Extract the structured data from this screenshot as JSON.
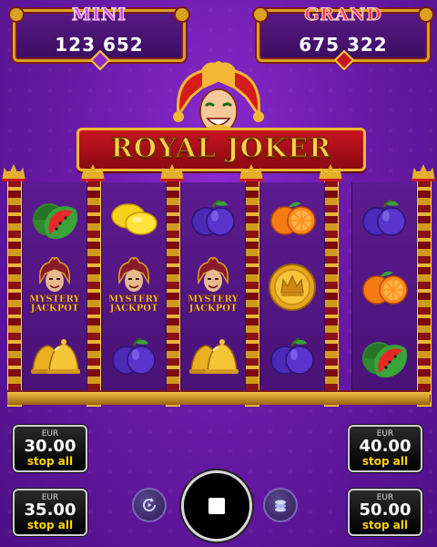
{
  "game": {
    "logo_text": "ROYAL JOKER"
  },
  "jackpots": {
    "mini": {
      "label": "MINI",
      "value": "123 652"
    },
    "grand": {
      "label": "GRAND",
      "value": "675 322"
    }
  },
  "reels": [
    [
      "watermelon-icon",
      "mystery-jackpot-icon",
      "bells-icon"
    ],
    [
      "lemon-icon",
      "mystery-jackpot-icon",
      "plums-icon"
    ],
    [
      "plums-icon",
      "mystery-jackpot-icon",
      "bells-icon"
    ],
    [
      "oranges-icon",
      "crown-coin-icon",
      "plums-icon"
    ],
    [
      "plums-icon",
      "oranges-icon",
      "watermelon-icon"
    ]
  ],
  "mystery_jackpot_label": "MYSTERY JACKPOT",
  "bet_buttons": [
    {
      "currency": "EUR",
      "amount": "30.00",
      "action": "stop all"
    },
    {
      "currency": "EUR",
      "amount": "35.00",
      "action": "stop all"
    },
    {
      "currency": "EUR",
      "amount": "40.00",
      "action": "stop all"
    },
    {
      "currency": "EUR",
      "amount": "50.00",
      "action": "stop all"
    }
  ],
  "controls": {
    "autoplay_icon": "autoplay-icon",
    "spin_icon": "stop-icon",
    "stake_icon": "coins-stack-icon"
  },
  "colors": {
    "background": "#6a1aa8",
    "gold": "#d9a21f",
    "red": "#c8141f",
    "stop_text": "#ffd400"
  }
}
